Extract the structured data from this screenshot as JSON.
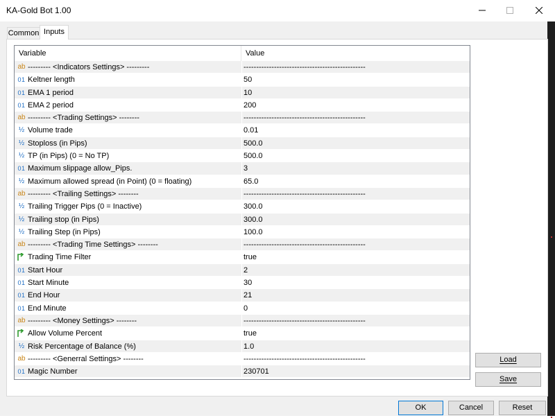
{
  "window": {
    "title": "KA-Gold Bot 1.00"
  },
  "tabs": [
    {
      "label": "Common",
      "active": false
    },
    {
      "label": "Inputs",
      "active": true
    }
  ],
  "table": {
    "columns": {
      "variable": "Variable",
      "value": "Value"
    },
    "rows": [
      {
        "icon": "string-icon",
        "glyph": "ab",
        "variable": "--------- <Indicators Settings> ---------",
        "value": "------------------------------------------------"
      },
      {
        "icon": "integer-icon",
        "glyph": "01",
        "variable": "Keltner length",
        "value": "50"
      },
      {
        "icon": "integer-icon",
        "glyph": "01",
        "variable": "EMA 1 period",
        "value": "10"
      },
      {
        "icon": "integer-icon",
        "glyph": "01",
        "variable": "EMA 2 period",
        "value": "200"
      },
      {
        "icon": "string-icon",
        "glyph": "ab",
        "variable": "--------- <Trading Settings> --------",
        "value": "------------------------------------------------"
      },
      {
        "icon": "double-icon",
        "glyph": "½",
        "variable": "Volume trade",
        "value": "0.01"
      },
      {
        "icon": "double-icon",
        "glyph": "½",
        "variable": "Stoploss (in Pips)",
        "value": "500.0"
      },
      {
        "icon": "double-icon",
        "glyph": "½",
        "variable": "TP (in Pips) (0 = No TP)",
        "value": "500.0"
      },
      {
        "icon": "integer-icon",
        "glyph": "01",
        "variable": "Maximum slippage allow_Pips.",
        "value": "3"
      },
      {
        "icon": "double-icon",
        "glyph": "½",
        "variable": "Maximum allowed spread (in Point) (0 = floating)",
        "value": "65.0"
      },
      {
        "icon": "string-icon",
        "glyph": "ab",
        "variable": "--------- <Trailing Settings> --------",
        "value": "------------------------------------------------"
      },
      {
        "icon": "double-icon",
        "glyph": "½",
        "variable": "Trailing Trigger Pips (0 = Inactive)",
        "value": "300.0"
      },
      {
        "icon": "double-icon",
        "glyph": "½",
        "variable": "Trailing stop (in Pips)",
        "value": "300.0"
      },
      {
        "icon": "double-icon",
        "glyph": "½",
        "variable": "Trailing Step (in Pips)",
        "value": "100.0"
      },
      {
        "icon": "string-icon",
        "glyph": "ab",
        "variable": "--------- <Trading Time Settings> --------",
        "value": "------------------------------------------------"
      },
      {
        "icon": "bool-icon",
        "glyph": "",
        "variable": "Trading Time Filter",
        "value": "true"
      },
      {
        "icon": "integer-icon",
        "glyph": "01",
        "variable": "Start Hour",
        "value": "2"
      },
      {
        "icon": "integer-icon",
        "glyph": "01",
        "variable": "Start Minute",
        "value": "30"
      },
      {
        "icon": "integer-icon",
        "glyph": "01",
        "variable": "End Hour",
        "value": "21"
      },
      {
        "icon": "integer-icon",
        "glyph": "01",
        "variable": "End Minute",
        "value": "0"
      },
      {
        "icon": "string-icon",
        "glyph": "ab",
        "variable": "--------- <Money Settings> --------",
        "value": "------------------------------------------------"
      },
      {
        "icon": "bool-icon",
        "glyph": "",
        "variable": "Allow Volume Percent",
        "value": "true"
      },
      {
        "icon": "double-icon",
        "glyph": "½",
        "variable": "Risk Percentage of Balance (%)",
        "value": "1.0"
      },
      {
        "icon": "string-icon",
        "glyph": "ab",
        "variable": "--------- <Generral Settings> --------",
        "value": "------------------------------------------------"
      },
      {
        "icon": "integer-icon",
        "glyph": "01",
        "variable": "Magic Number",
        "value": "230701"
      }
    ]
  },
  "side_buttons": {
    "load": "Load",
    "save": "Save"
  },
  "bottom_buttons": {
    "ok": "OK",
    "cancel": "Cancel",
    "reset": "Reset"
  },
  "colors": {
    "accent": "#0078d7",
    "string_icon": "#c9861a",
    "numeric_icon": "#1f6fc6",
    "bool_icon": "#2e9b2e"
  }
}
